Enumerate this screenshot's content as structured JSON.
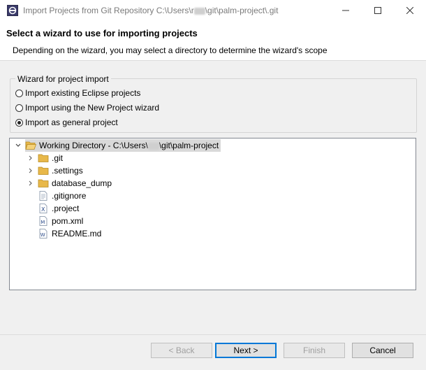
{
  "window": {
    "title": "Import Projects from Git Repository C:\\Users\\r",
    "title_suffix": "\\git\\palm-project\\.git",
    "minimize_icon": "minimize-icon",
    "maximize_icon": "maximize-icon",
    "close_icon": "close-icon"
  },
  "header": {
    "title": "Select a wizard to use for importing projects",
    "description": "Depending on the wizard, you may select a directory to determine the wizard's scope"
  },
  "wizard_group": {
    "legend": "Wizard for project import",
    "options": [
      {
        "label": "Import existing Eclipse projects",
        "selected": false
      },
      {
        "label": "Import using the New Project wizard",
        "selected": false
      },
      {
        "label": "Import as general project",
        "selected": true
      }
    ]
  },
  "tree": {
    "root": {
      "label_prefix": "Working Directory - C:\\Users\\",
      "label_suffix": "\\git\\palm-project",
      "icon": "open-folder-icon",
      "expanded": true
    },
    "items": [
      {
        "label": ".git",
        "icon": "folder-icon",
        "expandable": true
      },
      {
        "label": ".settings",
        "icon": "folder-icon",
        "expandable": true
      },
      {
        "label": "database_dump",
        "icon": "folder-icon",
        "expandable": true
      },
      {
        "label": ".gitignore",
        "icon": "text-file-icon",
        "expandable": false
      },
      {
        "label": ".project",
        "icon": "xml-file-icon",
        "expandable": false
      },
      {
        "label": "pom.xml",
        "icon": "maven-file-icon",
        "expandable": false
      },
      {
        "label": "README.md",
        "icon": "markdown-file-icon",
        "expandable": false
      }
    ]
  },
  "buttons": {
    "back": "< Back",
    "next": "Next >",
    "finish": "Finish",
    "cancel": "Cancel"
  },
  "colors": {
    "focus_border": "#0078d7",
    "folder": "#e8b84a"
  }
}
